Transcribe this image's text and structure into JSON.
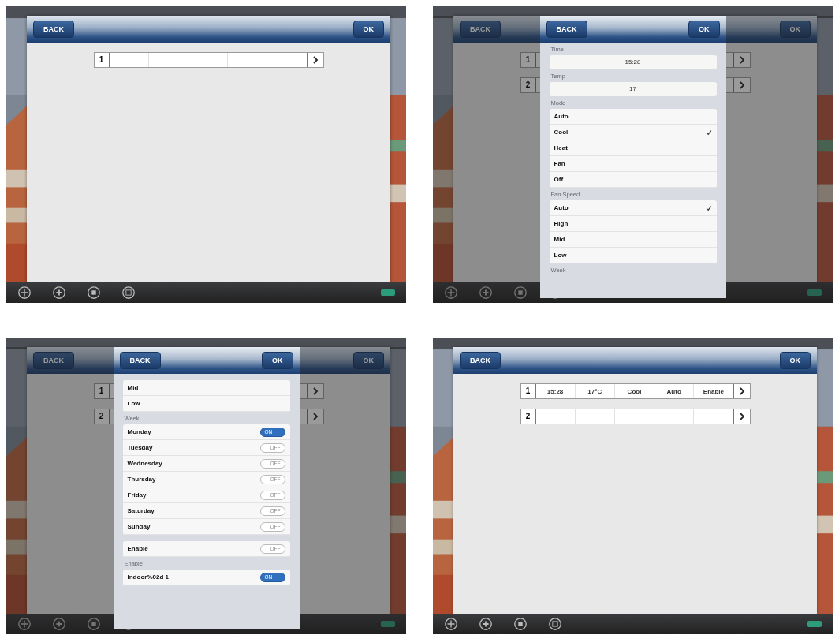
{
  "panels": [
    {
      "screen": {
        "back": "BACK",
        "ok": "OK",
        "rows": [
          {
            "index": "1"
          }
        ]
      }
    },
    {
      "screen": {
        "back": "BACK",
        "ok": "OK",
        "rows": [
          {
            "index": "1"
          },
          {
            "index": "2"
          }
        ]
      },
      "popover": {
        "back": "BACK",
        "ok": "OK",
        "sections": [
          {
            "kind": "field",
            "label": "Time",
            "value": "15:28"
          },
          {
            "kind": "field",
            "label": "Temp",
            "value": "17"
          },
          {
            "kind": "options",
            "label": "Mode",
            "items": [
              {
                "label": "Auto",
                "selected": false
              },
              {
                "label": "Cool",
                "selected": true
              },
              {
                "label": "Heat",
                "selected": false
              },
              {
                "label": "Fan",
                "selected": false
              },
              {
                "label": "Off",
                "selected": false
              }
            ]
          },
          {
            "kind": "options",
            "label": "Fan Speed",
            "items": [
              {
                "label": "Auto",
                "selected": true
              },
              {
                "label": "High",
                "selected": false
              },
              {
                "label": "Mid",
                "selected": false
              },
              {
                "label": "Low",
                "selected": false
              }
            ]
          },
          {
            "kind": "options",
            "label": "Week"
          }
        ]
      }
    },
    {
      "screen": {
        "back": "BACK",
        "ok": "OK",
        "rows": [
          {
            "index": "1"
          },
          {
            "index": "2"
          }
        ]
      },
      "popover": {
        "back": "BACK",
        "ok": "OK",
        "sections": [
          {
            "kind": "options",
            "items": [
              {
                "label": "Mid",
                "selected": false
              },
              {
                "label": "Low",
                "selected": false
              }
            ]
          },
          {
            "kind": "toggles",
            "label": "Week",
            "items": [
              {
                "label": "Monday",
                "on": true,
                "switch_text": "ON"
              },
              {
                "label": "Tuesday",
                "on": false,
                "switch_text": "OFF"
              },
              {
                "label": "Wednesday",
                "on": false,
                "switch_text": "OFF"
              },
              {
                "label": "Thursday",
                "on": false,
                "switch_text": "OFF"
              },
              {
                "label": "Friday",
                "on": false,
                "switch_text": "OFF"
              },
              {
                "label": "Saturday",
                "on": false,
                "switch_text": "OFF"
              },
              {
                "label": "Sunday",
                "on": false,
                "switch_text": "OFF"
              }
            ]
          },
          {
            "kind": "toggles",
            "items": [
              {
                "label": "Enable",
                "on": false,
                "switch_text": "OFF"
              }
            ]
          },
          {
            "kind": "toggles",
            "label": "Enable",
            "items": [
              {
                "label": "Indoor%02d 1",
                "on": true,
                "switch_text": "ON"
              }
            ]
          }
        ]
      }
    },
    {
      "screen": {
        "back": "BACK",
        "ok": "OK",
        "rows": [
          {
            "index": "1",
            "cells": [
              "15:28",
              "17°C",
              "Cool",
              "Auto",
              "Enable"
            ]
          },
          {
            "index": "2"
          }
        ]
      }
    }
  ]
}
